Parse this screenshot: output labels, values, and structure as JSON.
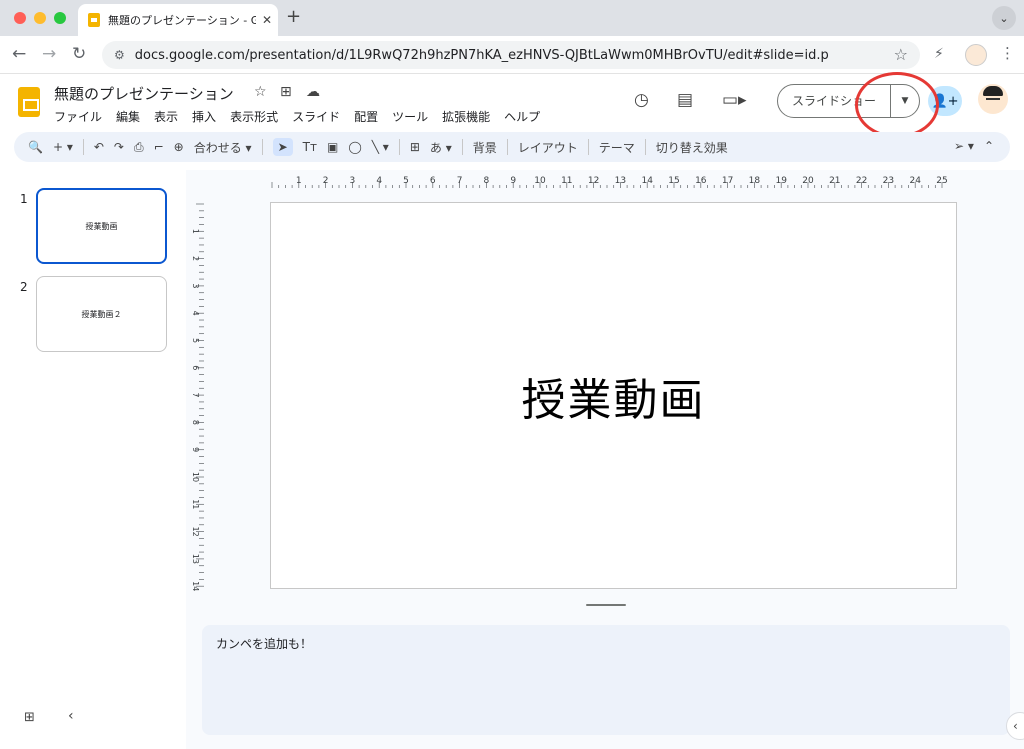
{
  "browser": {
    "tab_title": "無題のプレゼンテーション - Goo",
    "tab_close": "✕",
    "new_tab": "+",
    "tab_menu": "⌄",
    "url": "docs.google.com/presentation/d/1L9RwQ72h9hzPN7hKA_ezHNVS-QJBtLaWwm0MHBrOvTU/edit#slide=id.p",
    "icons": [
      "back-icon",
      "forward-icon",
      "reload-icon",
      "site-settings-icon",
      "bookmark-star-icon",
      "extension-icon",
      "profile-icon",
      "kebab-menu-icon"
    ]
  },
  "header": {
    "title": "無題のプレゼンテーション",
    "menus": [
      "ファイル",
      "編集",
      "表示",
      "挿入",
      "表示形式",
      "スライド",
      "配置",
      "ツール",
      "拡張機能",
      "ヘルプ"
    ],
    "slideshow_label": "スライドショー",
    "accent_color": "#0b57d0",
    "share_bg": "#c2e7ff"
  },
  "toolbar": {
    "zoom_label": "合わせる",
    "background": "背景",
    "layout": "レイアウト",
    "theme": "テーマ",
    "transition": "切り替え効果",
    "text_style": "あ"
  },
  "filmstrip": {
    "slides": [
      {
        "number": "1",
        "title": "授業動画"
      },
      {
        "number": "2",
        "title": "授業動画２"
      }
    ]
  },
  "ruler": {
    "h_labels": [
      "1",
      "2",
      "3",
      "4",
      "5",
      "6",
      "7",
      "8",
      "9",
      "10",
      "11",
      "12",
      "13",
      "14",
      "15",
      "16",
      "17",
      "18",
      "19",
      "20",
      "21",
      "22",
      "23",
      "24",
      "25"
    ],
    "v_labels": [
      "1",
      "2",
      "3",
      "4",
      "5",
      "6",
      "7",
      "8",
      "9",
      "10",
      "11",
      "12",
      "13",
      "14"
    ]
  },
  "canvas": {
    "slide_text": "授業動画"
  },
  "notes": {
    "text": "カンペを追加も！"
  },
  "annotation": {
    "highlight_color": "#e53935"
  }
}
